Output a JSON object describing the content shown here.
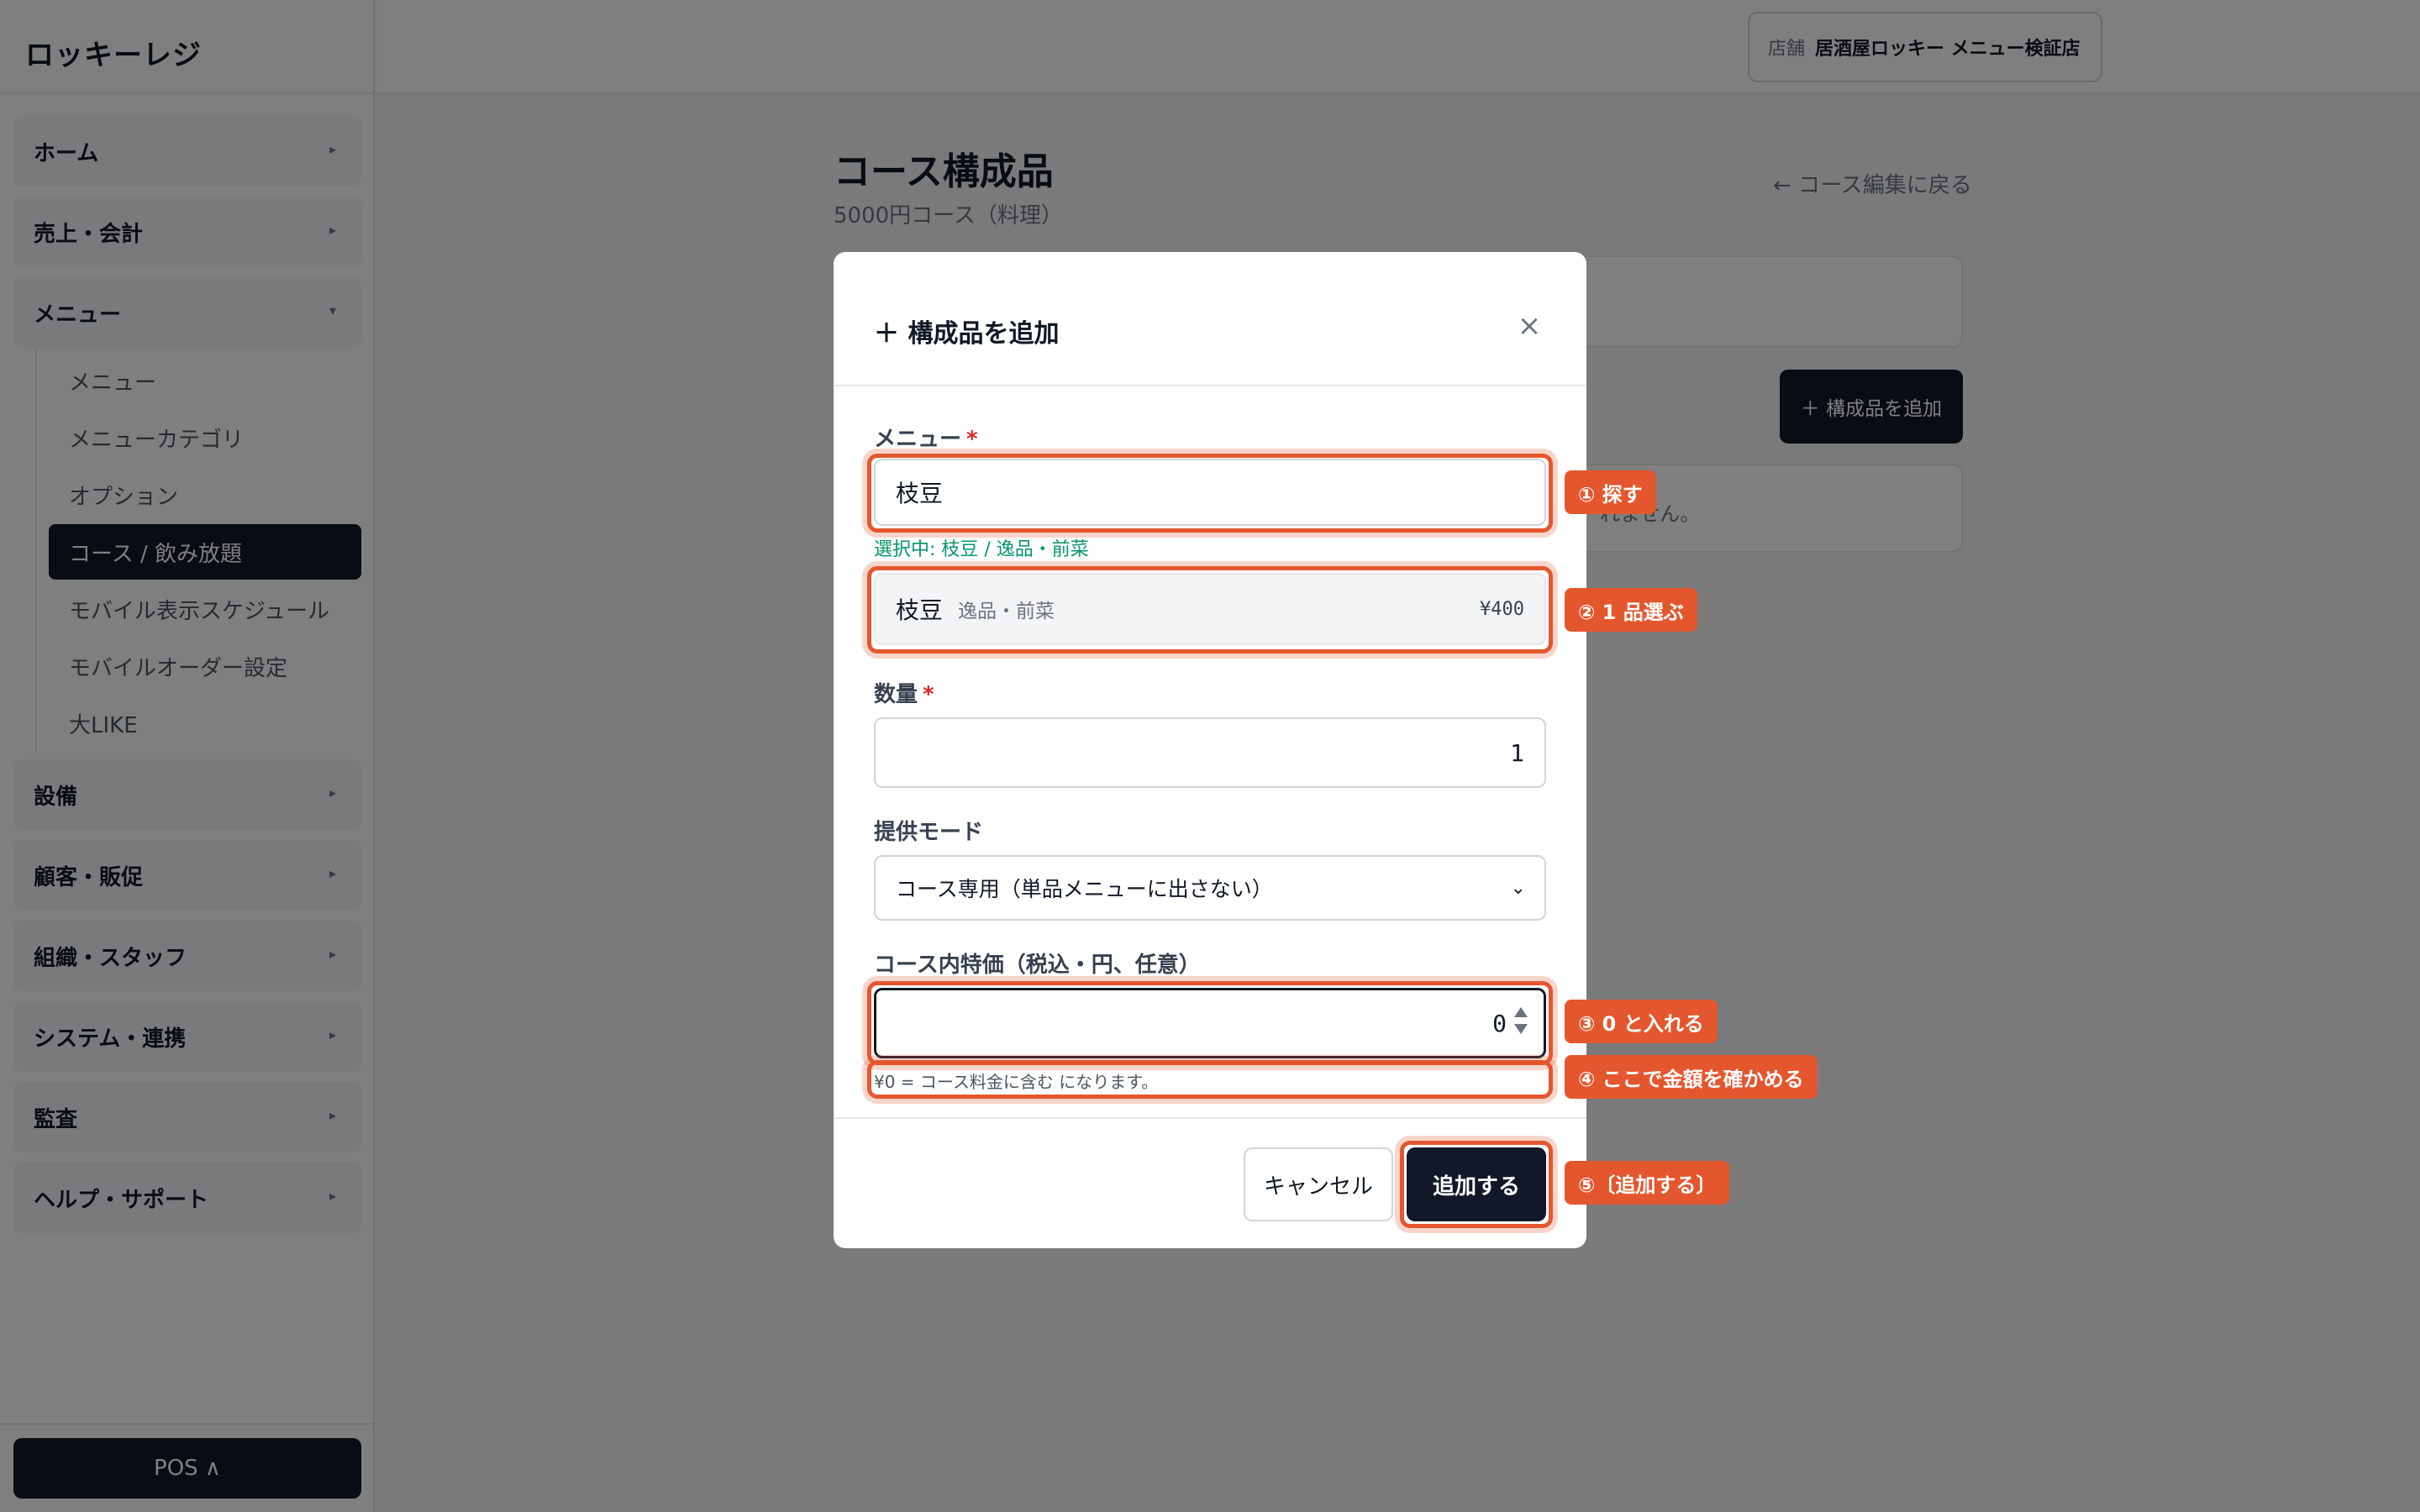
{
  "app": {
    "brand": "ロッキーレジ"
  },
  "sidebar": {
    "groups": [
      {
        "label": "ホーム"
      },
      {
        "label": "売上・会計"
      },
      {
        "label": "メニュー"
      },
      {
        "label": "設備"
      },
      {
        "label": "顧客・販促"
      },
      {
        "label": "組織・スタッフ"
      },
      {
        "label": "システム・連携"
      },
      {
        "label": "監査"
      },
      {
        "label": "ヘルプ・サポート"
      }
    ],
    "menu_items": [
      {
        "label": "メニュー"
      },
      {
        "label": "メニューカテゴリ"
      },
      {
        "label": "オプション"
      },
      {
        "label": "コース / 飲み放題"
      },
      {
        "label": "モバイル表示スケジュール"
      },
      {
        "label": "モバイルオーダー設定"
      },
      {
        "label": "大LIKE"
      }
    ],
    "pos_button": "POS ∧"
  },
  "header": {
    "store_key": "店舗",
    "store_name": "居酒屋ロッキー メニュー検証店"
  },
  "page": {
    "title": "コース構成品",
    "subtitle": "5000円コース（料理）",
    "back_link": "← コース編集に戻る",
    "add_button": "＋ 構成品を追加",
    "empty_text": "れません。"
  },
  "modal": {
    "title": "＋ 構成品を追加",
    "close": "×",
    "menu_label": "メニュー",
    "required_mark": "*",
    "search_value": "枝豆",
    "selected_note": "選択中: 枝豆 / 逸品・前菜",
    "result": {
      "name": "枝豆",
      "category": "逸品・前菜",
      "price": "¥400"
    },
    "qty_label": "数量",
    "qty_value": "1",
    "mode_label": "提供モード",
    "mode_value": "コース専用（単品メニューに出さない）",
    "price_label": "コース内特価（税込・円、任意）",
    "price_value": "0",
    "price_hint": "¥0 = コース料金に含む になります。",
    "cancel": "キャンセル",
    "submit": "追加する"
  },
  "annotations": {
    "step1": "① 探す",
    "step2": "② 1 品選ぶ",
    "step3": "③ 0 と入れる",
    "step4": "④ ここで金額を確かめる",
    "step5": "⑤〔追加する〕"
  },
  "colors": {
    "accent": "#e4572e",
    "primary": "#111827",
    "success": "#059669"
  }
}
